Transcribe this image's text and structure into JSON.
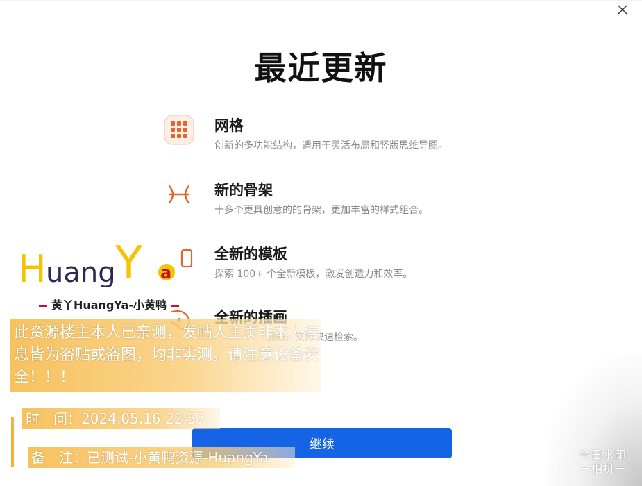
{
  "dialog": {
    "title": "最近更新",
    "close_label": "×",
    "continue_label": "继续"
  },
  "features": [
    {
      "title": "网格",
      "desc": "创新的多功能结构，适用于灵活布局和竖版思维导图。",
      "icon": "grid-icon"
    },
    {
      "title": "新的骨架",
      "desc": "十多个更具创意的的骨架，更加丰富的样式组合。",
      "icon": "skeleton-icon"
    },
    {
      "title": "全新的模板",
      "desc": "探索 100+ 个全新模板，激发创造力和效率。",
      "icon": "template-icon"
    },
    {
      "title": "全新的插画",
      "desc": "插画，支持快速检索。",
      "icon": "illustration-icon"
    }
  ],
  "watermark": {
    "brand_text": "HuangYa",
    "brand_subtitle": "黄丫HuangYa-小黄鸭",
    "notice": "此资源楼主本人已亲测，发帖人主页非本人信息皆为盗贴或盗图，均非实测，请注意设备安全！！！",
    "time_row": "时　间：2024.05.16 22:57",
    "note_row": "备　注：已测试-小黄鸭资源-HuangYa",
    "camera_line1": "今日水印",
    "camera_line2": "－相机－"
  },
  "colors": {
    "accent": "#1664e6",
    "icon_orange": "#e8622c",
    "watermark_yellow": "#f4b23a"
  }
}
